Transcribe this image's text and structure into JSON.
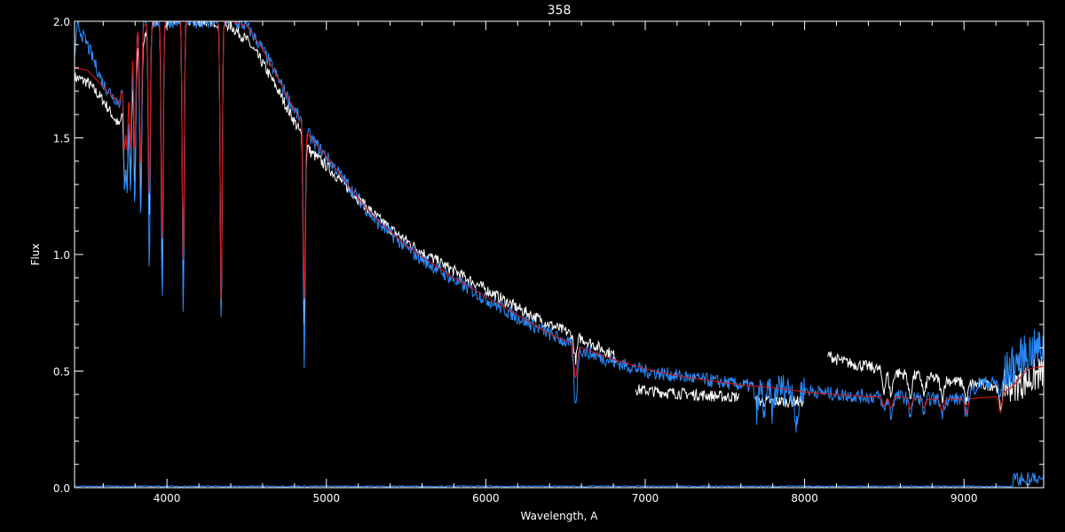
{
  "chart_data": {
    "type": "line",
    "title": "358",
    "xlabel": "Wavelength, A",
    "ylabel": "Flux",
    "xlim": [
      3420,
      9500
    ],
    "ylim": [
      0.0,
      2.0
    ],
    "x_ticks": [
      4000,
      5000,
      6000,
      7000,
      8000,
      9000
    ],
    "x_tick_labels": [
      "4000",
      "5000",
      "6000",
      "7000",
      "8000",
      "9000"
    ],
    "y_ticks": [
      0.0,
      0.5,
      1.0,
      1.5,
      2.0
    ],
    "y_tick_labels": [
      "0.0",
      "0.5",
      "1.0",
      "1.5",
      "2.0"
    ],
    "grid": false,
    "colors": {
      "background": "#000000",
      "axes": "#ffffff",
      "white_spectrum": "#ffffff",
      "blue_spectrum": "#2a8cff",
      "red_model": "#d01818"
    },
    "series": [
      {
        "color": "#d01818",
        "x": [
          3420,
          3500,
          3600,
          3700,
          3800,
          3900,
          4000,
          4100,
          4200,
          4300,
          4400,
          4500,
          4600,
          4700,
          4800,
          4900,
          5000,
          5100,
          5200,
          5300,
          5400,
          5500,
          5600,
          5800,
          6000,
          6200,
          6400,
          6600,
          6800,
          7000,
          7200,
          7400,
          7600,
          7800,
          8000,
          8200,
          8400,
          8600,
          8800,
          9000,
          9200,
          9300,
          9400,
          9500
        ],
        "y": [
          1.8,
          1.79,
          1.72,
          1.65,
          1.96,
          2.0,
          2.0,
          2.0,
          2.0,
          2.0,
          2.0,
          1.98,
          1.88,
          1.75,
          1.62,
          1.5,
          1.42,
          1.33,
          1.24,
          1.16,
          1.1,
          1.04,
          0.99,
          0.9,
          0.82,
          0.74,
          0.66,
          0.6,
          0.55,
          0.51,
          0.48,
          0.46,
          0.44,
          0.43,
          0.41,
          0.4,
          0.39,
          0.39,
          0.38,
          0.38,
          0.39,
          0.43,
          0.51,
          0.52
        ],
        "absorption_lines": [
          [
            3734,
            0.3
          ],
          [
            3750,
            0.35
          ],
          [
            3771,
            0.42
          ],
          [
            3798,
            0.52
          ],
          [
            3835,
            0.6
          ],
          [
            3889,
            0.75
          ],
          [
            3970,
            0.95
          ],
          [
            4102,
            1.05
          ],
          [
            4340,
            1.22
          ],
          [
            4861,
            0.74
          ],
          [
            6563,
            0.14
          ],
          [
            8498,
            0.04
          ],
          [
            8542,
            0.05
          ],
          [
            8662,
            0.05
          ],
          [
            8750,
            0.04
          ],
          [
            8863,
            0.05
          ],
          [
            9015,
            0.06
          ],
          [
            9229,
            0.08
          ]
        ]
      },
      {
        "color": "#ffffff",
        "x": [
          3420,
          3500,
          3600,
          3700,
          3800,
          3900,
          4000,
          4100,
          4200,
          4300,
          4400,
          4500,
          4600,
          4700,
          4800,
          4900,
          5000,
          5100,
          5200,
          5300,
          5400,
          5500,
          5600,
          5800,
          6000,
          6200,
          6400,
          6600,
          6800,
          6950,
          7100,
          7300,
          7500,
          7600,
          7700,
          7800,
          7900,
          8000,
          8100,
          8150,
          8200,
          8300,
          8400,
          8500,
          8600,
          8700,
          8800,
          8900,
          9000,
          9100,
          9200,
          9300,
          9400,
          9500
        ],
        "y": [
          1.76,
          1.74,
          1.66,
          1.55,
          1.85,
          2.0,
          2.0,
          2.0,
          2.0,
          2.0,
          1.98,
          1.92,
          1.82,
          1.7,
          1.57,
          1.44,
          1.38,
          1.31,
          1.24,
          1.17,
          1.11,
          1.06,
          1.01,
          0.93,
          0.85,
          0.77,
          0.7,
          0.64,
          0.57,
          0.42,
          0.41,
          0.4,
          0.39,
          0.39,
          0.37,
          0.37,
          0.37,
          0.37,
          0.38,
          0.57,
          0.55,
          0.53,
          0.52,
          0.5,
          0.49,
          0.48,
          0.47,
          0.46,
          0.45,
          0.44,
          0.44,
          0.44,
          0.46,
          0.5
        ],
        "gaps": [
          [
            6820,
            6940
          ],
          [
            7590,
            7690
          ],
          [
            8000,
            8140
          ]
        ],
        "absorption_lines": [
          [
            3734,
            0.35
          ],
          [
            3750,
            0.4
          ],
          [
            3771,
            0.45
          ],
          [
            3798,
            0.55
          ],
          [
            3835,
            0.7
          ],
          [
            3889,
            0.85
          ],
          [
            3970,
            1.1
          ],
          [
            4102,
            1.15
          ],
          [
            4340,
            1.25
          ],
          [
            4861,
            0.8
          ],
          [
            6563,
            0.1
          ],
          [
            8498,
            0.08
          ],
          [
            8542,
            0.1
          ],
          [
            8662,
            0.1
          ],
          [
            8750,
            0.08
          ],
          [
            8863,
            0.08
          ],
          [
            9015,
            0.08
          ],
          [
            9229,
            0.1
          ]
        ]
      },
      {
        "color": "#2a8cff",
        "x": [
          3420,
          3440,
          3500,
          3600,
          3700,
          3800,
          3900,
          4000,
          4100,
          4200,
          4300,
          4400,
          4500,
          4600,
          4700,
          4800,
          4900,
          5000,
          5100,
          5200,
          5300,
          5400,
          5500,
          5600,
          5800,
          6000,
          6200,
          6400,
          6600,
          6800,
          7000,
          7200,
          7400,
          7600,
          7800,
          8000,
          8200,
          8400,
          8600,
          8800,
          9000,
          9100,
          9200,
          9300,
          9400,
          9500
        ],
        "y": [
          1.85,
          1.98,
          1.9,
          1.73,
          1.65,
          1.96,
          2.0,
          2.0,
          2.0,
          2.0,
          2.0,
          2.0,
          1.98,
          1.88,
          1.75,
          1.62,
          1.5,
          1.42,
          1.33,
          1.24,
          1.15,
          1.09,
          1.03,
          0.98,
          0.89,
          0.81,
          0.73,
          0.66,
          0.59,
          0.54,
          0.5,
          0.48,
          0.46,
          0.44,
          0.43,
          0.42,
          0.4,
          0.39,
          0.39,
          0.38,
          0.38,
          0.45,
          0.45,
          0.52,
          0.58,
          0.6
        ],
        "absorption_lines": [
          [
            3734,
            0.45
          ],
          [
            3750,
            0.52
          ],
          [
            3771,
            0.6
          ],
          [
            3798,
            0.75
          ],
          [
            3835,
            0.85
          ],
          [
            3889,
            1.05
          ],
          [
            3970,
            1.2
          ],
          [
            4102,
            1.25
          ],
          [
            4340,
            1.3
          ],
          [
            4861,
            1.03
          ],
          [
            6563,
            0.26
          ],
          [
            7700,
            0.1
          ],
          [
            7750,
            0.12
          ],
          [
            7800,
            0.1
          ],
          [
            7950,
            0.18
          ],
          [
            8498,
            0.06
          ],
          [
            8542,
            0.08
          ],
          [
            8662,
            0.07
          ],
          [
            8750,
            0.06
          ],
          [
            8863,
            0.06
          ],
          [
            9015,
            0.07
          ],
          [
            9229,
            0.08
          ]
        ]
      }
    ]
  }
}
